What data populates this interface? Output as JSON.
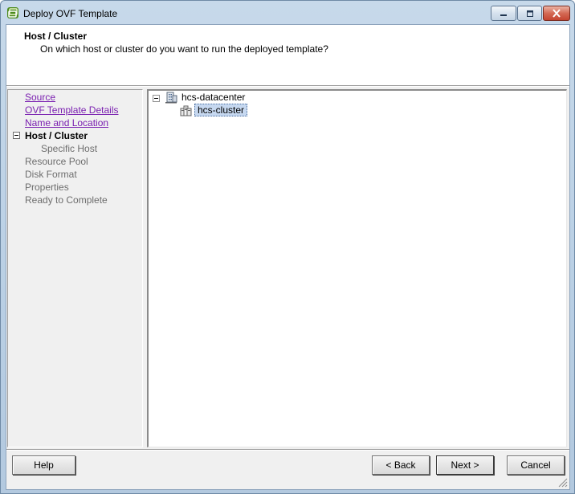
{
  "window": {
    "title": "Deploy OVF Template",
    "controls": [
      "minimize",
      "maximize",
      "close"
    ]
  },
  "header": {
    "title": "Host / Cluster",
    "subtitle": "On which host or cluster do you want to run the deployed template?"
  },
  "steps": [
    {
      "label": "Source",
      "state": "link"
    },
    {
      "label": "OVF Template Details",
      "state": "link"
    },
    {
      "label": "Name and Location",
      "state": "link"
    },
    {
      "label": "Host / Cluster",
      "state": "current"
    },
    {
      "label": "Specific Host",
      "state": "sub"
    },
    {
      "label": "Resource Pool",
      "state": "pending"
    },
    {
      "label": "Disk Format",
      "state": "pending"
    },
    {
      "label": "Properties",
      "state": "pending"
    },
    {
      "label": "Ready to Complete",
      "state": "pending"
    }
  ],
  "tree": {
    "datacenter": {
      "label": "hcs-datacenter",
      "icon": "datacenter-icon",
      "expanded": true
    },
    "cluster": {
      "label": "hcs-cluster",
      "icon": "cluster-icon",
      "selected": true
    }
  },
  "buttons": {
    "help": "Help",
    "back": "< Back",
    "next": "Next >",
    "cancel": "Cancel"
  },
  "colors": {
    "link": "#7a1fb0",
    "pending": "#6d6d6d",
    "selection": "#c6d8f0"
  }
}
